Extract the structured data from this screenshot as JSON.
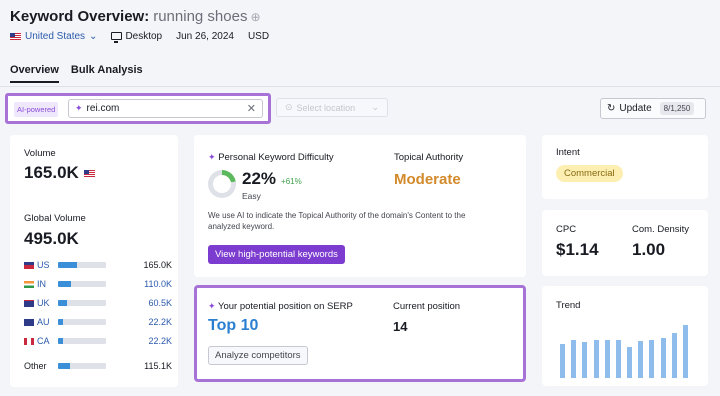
{
  "header": {
    "title": "Keyword Overview:",
    "keyword": "running shoes",
    "plus": "⊕",
    "database": "United States",
    "device": "Desktop",
    "date": "Jun 26, 2024",
    "currency": "USD"
  },
  "tabs": [
    "Overview",
    "Bulk Analysis"
  ],
  "toolbar": {
    "ai_label": "AI-powered",
    "domain_value": "rei.com",
    "location_placeholder": "Select location",
    "update_label": "Update",
    "update_count": "8/1,250"
  },
  "volume": {
    "label": "Volume",
    "value": "165.0K",
    "global_label": "Global Volume",
    "global_value": "495.0K",
    "countries": [
      {
        "code": "US",
        "value": "165.0K",
        "share": 0.4,
        "link": false
      },
      {
        "code": "IN",
        "value": "110.0K",
        "share": 0.28,
        "link": true
      },
      {
        "code": "UK",
        "value": "60.5K",
        "share": 0.18,
        "link": true
      },
      {
        "code": "AU",
        "value": "22.2K",
        "share": 0.1,
        "link": true
      },
      {
        "code": "CA",
        "value": "22.2K",
        "share": 0.1,
        "link": true
      }
    ],
    "other_label": "Other",
    "other_value": "115.1K",
    "other_share": 0.25
  },
  "kd": {
    "label": "Personal Keyword Difficulty",
    "value": "22%",
    "delta": "+61%",
    "level": "Easy",
    "percent": 22,
    "topical_label": "Topical Authority",
    "topical_value": "Moderate",
    "description": "We use AI to indicate the Topical Authority of the domain's Content to the analyzed keyword.",
    "button": "View high-potential keywords"
  },
  "serp": {
    "label": "Your potential position on SERP",
    "value": "Top 10",
    "current_label": "Current position",
    "current_value": "14",
    "button": "Analyze competitors"
  },
  "intent": {
    "label": "Intent",
    "value": "Commercial"
  },
  "cpc": {
    "label": "CPC",
    "value": "$1.14",
    "density_label": "Com. Density",
    "density_value": "1.00"
  },
  "trend": {
    "label": "Trend",
    "values": [
      0.55,
      0.62,
      0.58,
      0.62,
      0.62,
      0.62,
      0.5,
      0.6,
      0.62,
      0.65,
      0.72,
      0.85
    ]
  },
  "colors": {
    "accent_purple": "#a873d6",
    "button_purple": "#7c3ccf",
    "link_blue": "#2b5aac",
    "moderate": "#d38a2a"
  }
}
